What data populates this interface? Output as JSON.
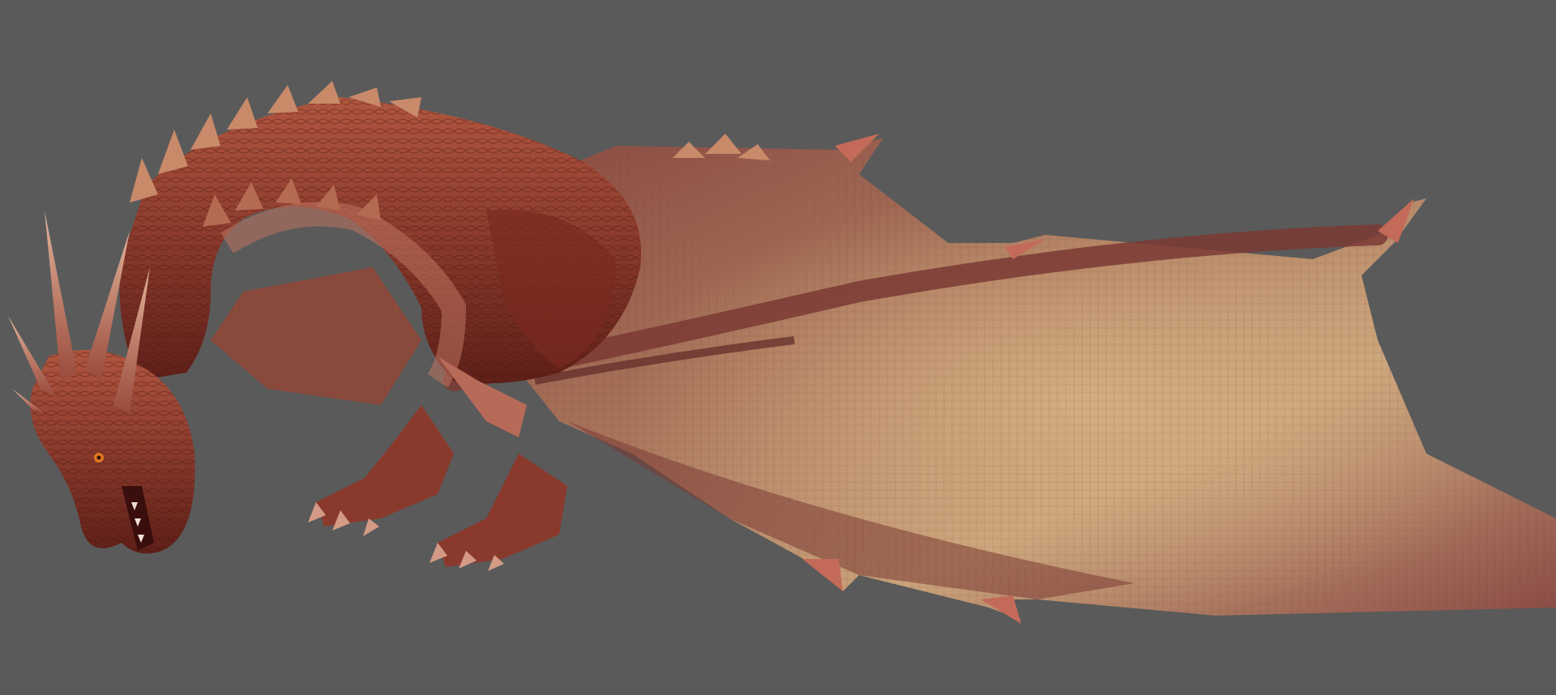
{
  "viewport": {
    "background_color": "#5a5a5a"
  },
  "model": {
    "subject": "dragon",
    "pose": "lying-down",
    "facing": "left",
    "wing_state": "spread",
    "colors": {
      "body": "#8a3a2c",
      "body_dark": "#5e1f18",
      "body_light": "#b0563f",
      "spines": "#c98a6a",
      "horn": "#c8927a",
      "wing_membrane_light": "#c9a27a",
      "wing_membrane_mid": "#a8745a",
      "wing_membrane_dark": "#7a3a34",
      "eye": "#e07a20"
    }
  }
}
